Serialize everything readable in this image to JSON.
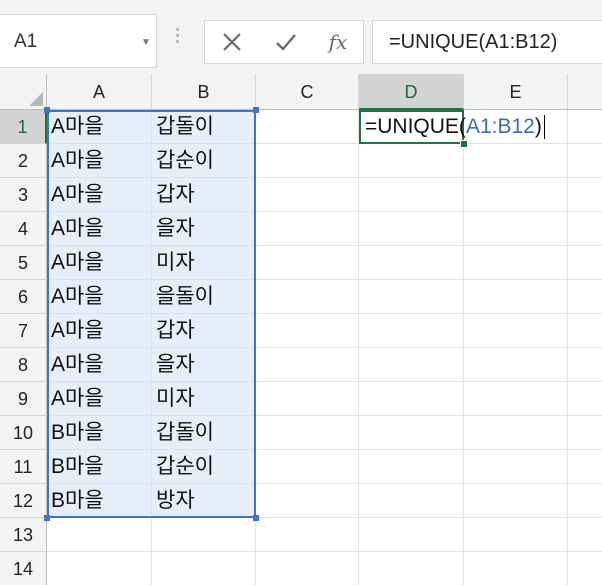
{
  "name_box": {
    "value": "A1"
  },
  "formula_bar": {
    "cancel_icon": "close-icon",
    "enter_icon": "checkmark-icon",
    "function_label": "fx",
    "formula": "=UNIQUE(A1:B12)"
  },
  "columns": [
    "A",
    "B",
    "C",
    "D",
    "E"
  ],
  "rows": [
    "1",
    "2",
    "3",
    "4",
    "5",
    "6",
    "7",
    "8",
    "9",
    "10",
    "11",
    "12",
    "13",
    "14"
  ],
  "active_column": "D",
  "active_row": "1",
  "data": [
    [
      "A마을",
      "갑돌이"
    ],
    [
      "A마을",
      "갑순이"
    ],
    [
      "A마을",
      "갑자"
    ],
    [
      "A마을",
      "을자"
    ],
    [
      "A마을",
      "미자"
    ],
    [
      "A마을",
      "을돌이"
    ],
    [
      "A마을",
      "갑자"
    ],
    [
      "A마을",
      "을자"
    ],
    [
      "A마을",
      "미자"
    ],
    [
      "B마을",
      "갑돌이"
    ],
    [
      "B마을",
      "갑순이"
    ],
    [
      "B마을",
      "방자"
    ]
  ],
  "editing_cell": {
    "address": "D1",
    "prefix": "=UNIQUE(",
    "reference": "A1:B12",
    "suffix": ")"
  },
  "colors": {
    "selection_border": "#4472c4",
    "selection_fill": "#e8eef9",
    "active_border": "#217346",
    "reference_text": "#3d6ab8"
  }
}
